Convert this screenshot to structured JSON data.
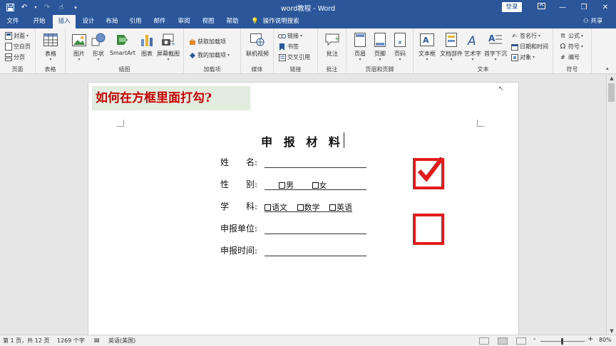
{
  "window": {
    "title": "word教程 - Word",
    "login_label": "登录",
    "qat_icons": [
      "save-icon",
      "undo-icon",
      "redo-icon",
      "touch-mode-icon",
      "customize-qat-icon"
    ]
  },
  "tabs": [
    "文件",
    "开始",
    "插入",
    "设计",
    "布局",
    "引用",
    "邮件",
    "审阅",
    "视图",
    "帮助"
  ],
  "active_tab": "插入",
  "tell_me": "操作说明搜索",
  "share_label": "共享",
  "ribbon": {
    "pages": {
      "label": "页面",
      "items": [
        "封面",
        "空白页",
        "分页"
      ]
    },
    "tables": {
      "label": "表格",
      "items": [
        "表格"
      ]
    },
    "illustrations": {
      "label": "插图",
      "items": [
        "图片",
        "形状",
        "SmartArt",
        "图表",
        "屏幕截图"
      ]
    },
    "addins": {
      "label": "加载项",
      "items": [
        "获取加载项",
        "我的加载项"
      ]
    },
    "media": {
      "label": "媒体",
      "items": [
        "联机视频"
      ]
    },
    "links": {
      "label": "链接",
      "items": [
        "链接",
        "书签",
        "交叉引用"
      ]
    },
    "comments": {
      "label": "批注",
      "items": [
        "批注"
      ]
    },
    "header_footer": {
      "label": "页眉和页脚",
      "items": [
        "页眉",
        "页脚",
        "页码"
      ]
    },
    "text": {
      "label": "文本",
      "items": [
        "文本框",
        "文档部件",
        "艺术字",
        "首字下沉",
        "签名行",
        "日期和时间",
        "对象"
      ]
    },
    "symbols": {
      "label": "符号",
      "items": [
        "公式",
        "符号",
        "编号"
      ]
    }
  },
  "document": {
    "banner": "如何在方框里面打勾?",
    "title": "申 报 材 料",
    "fields": [
      {
        "label": "姓　　名:"
      },
      {
        "label": "性　　别:",
        "options": [
          "男",
          "女"
        ]
      },
      {
        "label": "学　　科:",
        "options": [
          "语文",
          "数学",
          "英语"
        ]
      },
      {
        "label": "申报单位:"
      },
      {
        "label": "申报时间:"
      }
    ]
  },
  "status": {
    "page_info": "第 1 页，共 12 页",
    "word_count": "1269 个字",
    "language": "英语(美国)",
    "zoom": "80%",
    "zoom_minus": "-",
    "zoom_plus": "+"
  },
  "colors": {
    "title_bar": "#2b579a",
    "check_red": "#e31b1b",
    "banner_text": "#cc0000",
    "banner_bg": "#e3eddf"
  }
}
